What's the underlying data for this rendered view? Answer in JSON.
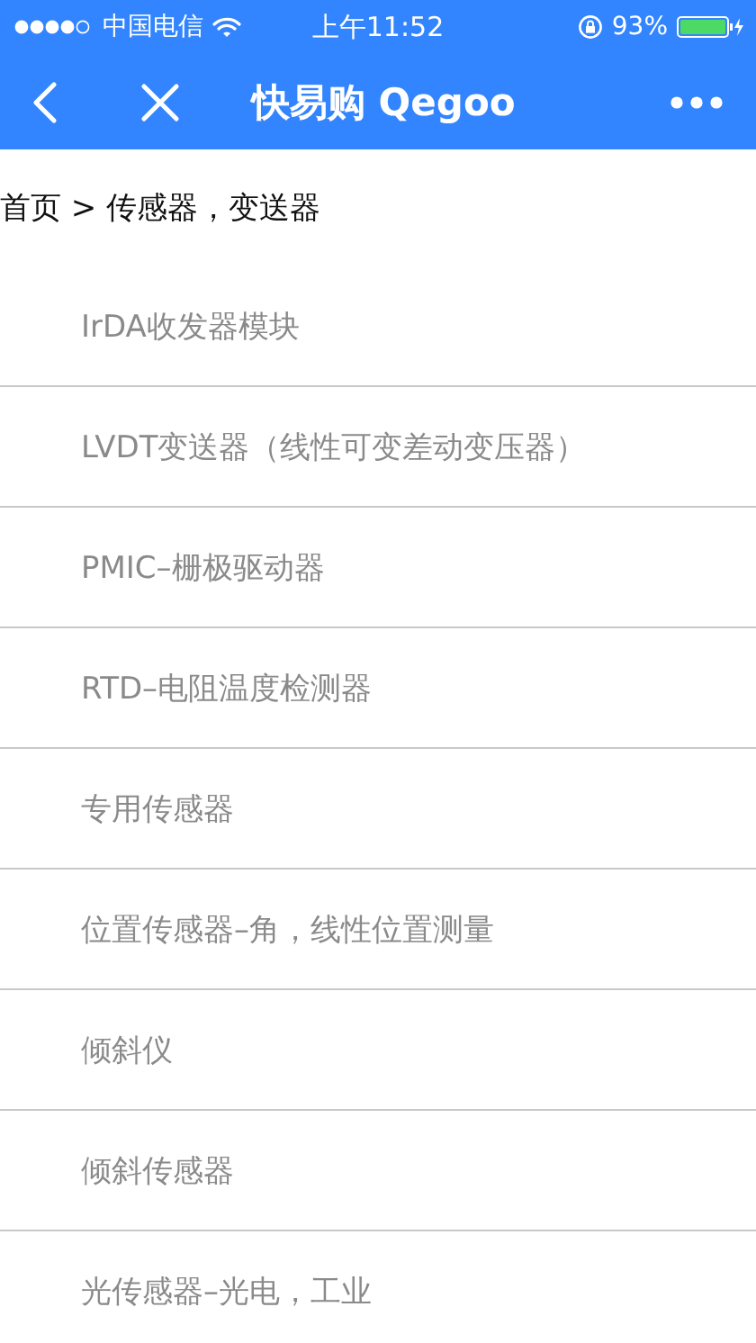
{
  "status_bar": {
    "carrier": "中国电信",
    "time": "上午11:52",
    "battery": "93%"
  },
  "nav_bar": {
    "title": "快易购 Qegoo"
  },
  "breadcrumb": "首页 > 传感器，变送器",
  "categories": [
    {
      "label": "IrDA收发器模块"
    },
    {
      "label": "LVDT变送器（线性可变差动变压器）"
    },
    {
      "label": "PMIC–栅极驱动器"
    },
    {
      "label": "RTD–电阻温度检测器"
    },
    {
      "label": "专用传感器"
    },
    {
      "label": "位置传感器–角，线性位置测量"
    },
    {
      "label": "倾斜仪"
    },
    {
      "label": "倾斜传感器"
    },
    {
      "label": "光传感器–光电，工业"
    }
  ]
}
